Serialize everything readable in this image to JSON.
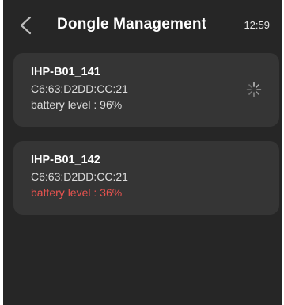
{
  "header": {
    "title": "Dongle Management",
    "time": "12:59",
    "back_icon": "chevron-left-icon"
  },
  "dongles": [
    {
      "name": "IHP-B01_141",
      "mac": "C6:63:D2DD:CC:21",
      "battery_label": "battery level : 96%",
      "battery_percent": 96,
      "status_icon": "loading-spinner-icon",
      "battery_color": "#dcdcdc"
    },
    {
      "name": "IHP-B01_142",
      "mac": "C6:63:D2DD:CC:21",
      "battery_label": "battery level : 36%",
      "battery_percent": 36,
      "battery_color": "#e8534f"
    }
  ],
  "colors": {
    "background": "#262626",
    "card": "#353535",
    "text": "#ffffff",
    "warning": "#e8534f"
  }
}
